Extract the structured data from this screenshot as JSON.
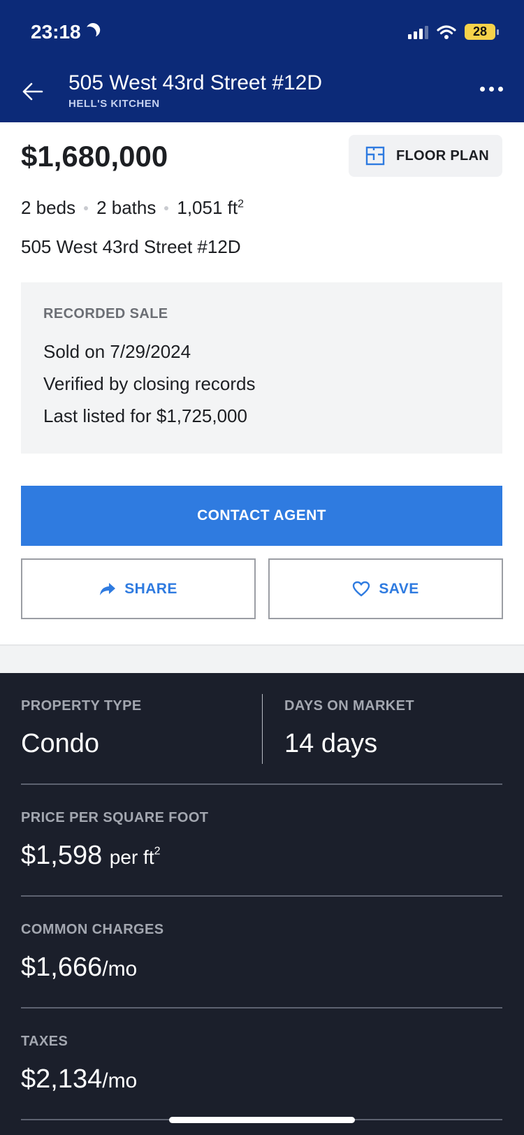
{
  "status_bar": {
    "time": "23:18",
    "battery": "28"
  },
  "nav": {
    "title": "505 West 43rd Street #12D",
    "subtitle": "HELL'S KITCHEN"
  },
  "listing": {
    "price": "$1,680,000",
    "floor_plan_label": "FLOOR PLAN",
    "beds": "2 beds",
    "baths": "2 baths",
    "area": "1,051 ft",
    "area_sup": "2",
    "address": "505 West 43rd Street #12D"
  },
  "recorded_sale": {
    "title": "RECORDED SALE",
    "sold_on": "Sold on 7/29/2024",
    "verified": "Verified by closing records",
    "last_listed": "Last listed for $1,725,000"
  },
  "actions": {
    "contact": "CONTACT AGENT",
    "share": "SHARE",
    "save": "SAVE"
  },
  "details": {
    "property_type_label": "PROPERTY TYPE",
    "property_type_value": "Condo",
    "days_label": "DAYS ON MARKET",
    "days_value": "14 days",
    "ppsf_label": "PRICE PER SQUARE FOOT",
    "ppsf_value": "$1,598",
    "ppsf_unit": "per ft",
    "ppsf_unit_sup": "2",
    "common_label": "COMMON CHARGES",
    "common_value": "$1,666",
    "common_unit": "/mo",
    "taxes_label": "TAXES",
    "taxes_value": "$2,134",
    "taxes_unit": "/mo"
  },
  "colors": {
    "header": "#0c2a78",
    "accent": "#2f7be0",
    "dark_panel": "#1b1f2b"
  },
  "icons": [
    "moon-icon",
    "signal-icon",
    "wifi-icon",
    "battery-icon",
    "back-arrow-icon",
    "more-icon",
    "floor-plan-icon",
    "share-icon",
    "heart-icon"
  ]
}
